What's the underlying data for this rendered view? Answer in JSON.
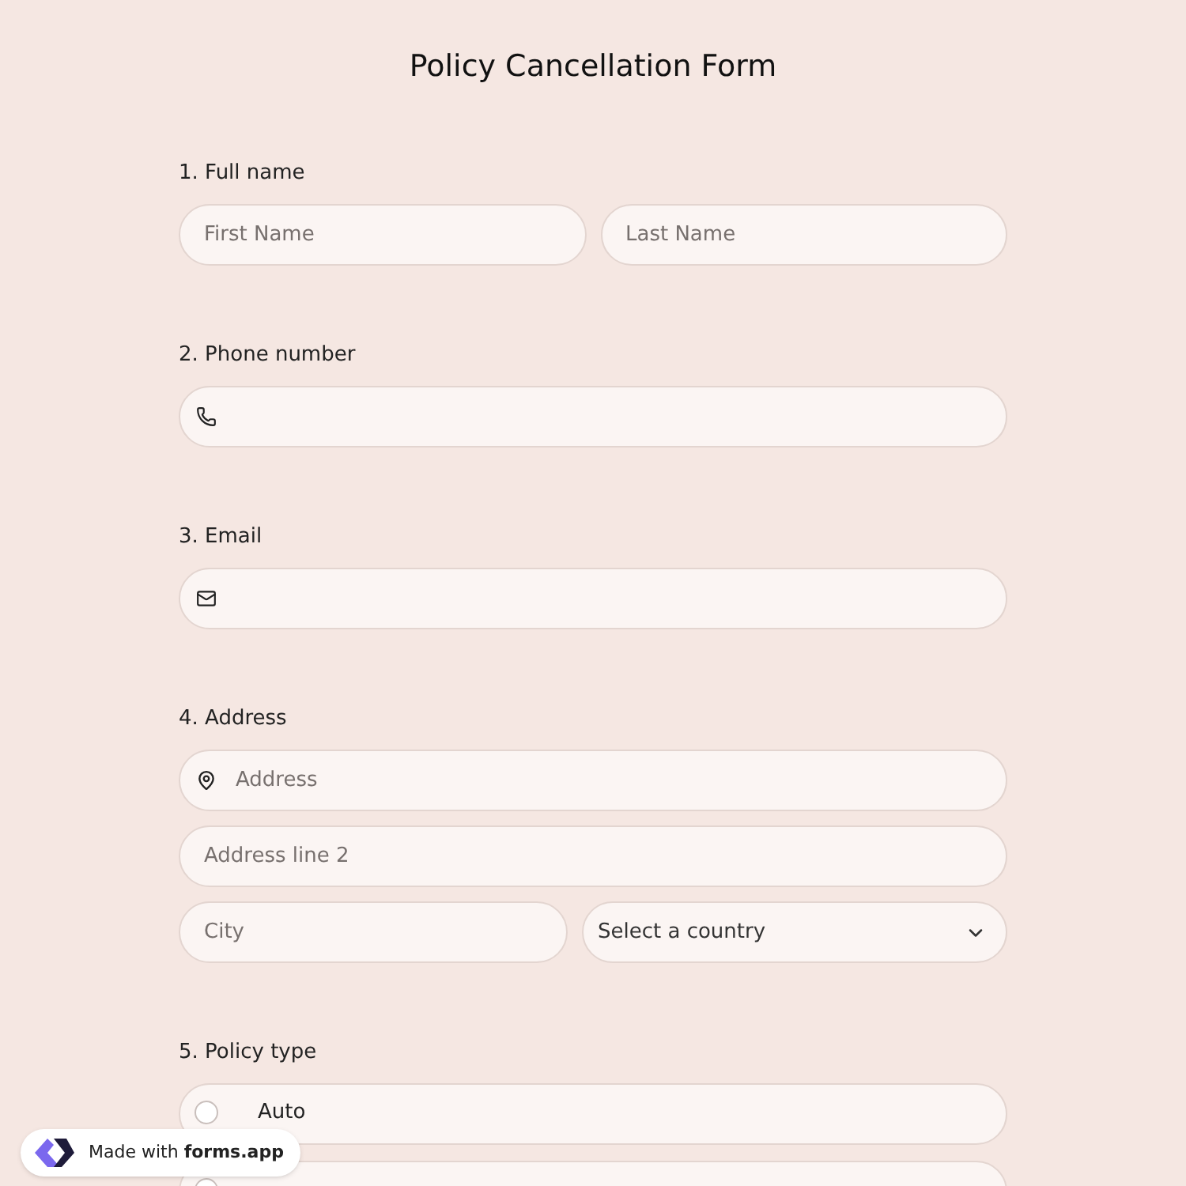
{
  "title": "Policy Cancellation Form",
  "questions": [
    {
      "number": "1.",
      "label": "Full name",
      "kind": "name",
      "fields": [
        {
          "placeholder": "First Name"
        },
        {
          "placeholder": "Last Name"
        }
      ]
    },
    {
      "number": "2.",
      "label": "Phone number",
      "kind": "phone"
    },
    {
      "number": "3.",
      "label": "Email",
      "kind": "email"
    },
    {
      "number": "4.",
      "label": "Address",
      "kind": "address",
      "address": {
        "placeholder": "Address"
      },
      "address_line_2": {
        "placeholder": "Address line 2"
      },
      "city": {
        "placeholder": "City"
      },
      "country": {
        "value": "Select a country"
      }
    },
    {
      "number": "5.",
      "label": "Policy type",
      "kind": "choice",
      "options": [
        {
          "label": "Auto",
          "selected": false
        },
        {
          "selected": false
        }
      ]
    }
  ],
  "badge": {
    "prefix": "Made with",
    "brand": "forms.app"
  }
}
